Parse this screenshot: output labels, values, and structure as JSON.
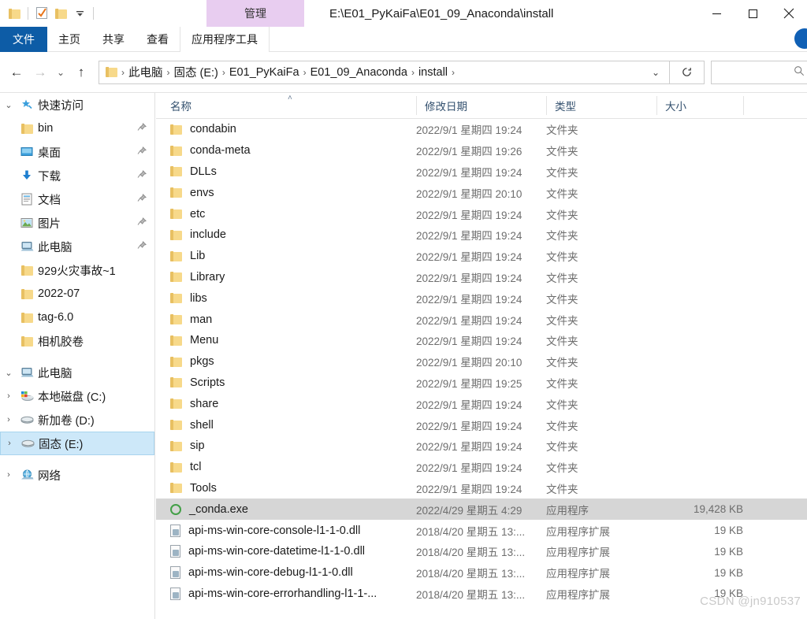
{
  "window": {
    "title": "E:\\E01_PyKaiFa\\E01_09_Anaconda\\install",
    "minimize_label": "─",
    "maximize_label": "☐",
    "close_label": "✕"
  },
  "quick_access_toolbar": {
    "items": [
      {
        "name": "explorer-folder-icon",
        "glyph": "folder"
      },
      {
        "name": "properties-icon",
        "glyph": "checkbox"
      },
      {
        "name": "new-folder-icon",
        "glyph": "folder"
      },
      {
        "name": "customize-dropdown-icon",
        "glyph": "▾"
      }
    ]
  },
  "ribbon": {
    "context_group_label": "管理",
    "tabs": [
      {
        "label": "文件",
        "selected": true,
        "kind": "file"
      },
      {
        "label": "主页",
        "selected": false,
        "kind": "normal"
      },
      {
        "label": "共享",
        "selected": false,
        "kind": "normal"
      },
      {
        "label": "查看",
        "selected": false,
        "kind": "normal"
      },
      {
        "label": "应用程序工具",
        "selected": false,
        "kind": "context"
      }
    ],
    "collapse_icon": "⌄",
    "help_icon": "help-circle"
  },
  "address_bar": {
    "back_icon": "←",
    "forward_icon": "→",
    "recent_icon": "⌄",
    "up_icon": "↑",
    "breadcrumbs": [
      "此电脑",
      "固态 (E:)",
      "E01_PyKaiFa",
      "E01_09_Anaconda",
      "install"
    ],
    "separator": "›",
    "dropdown_icon": "⌄",
    "refresh_icon": "↻",
    "search_placeholder": "",
    "search_value": "",
    "search_icon": "⌕"
  },
  "nav_pane": {
    "sections": [
      {
        "name": "quick-access",
        "expander": "⌄",
        "icon": "star-pin-icon",
        "label": "快速访问",
        "items": [
          {
            "label": "bin",
            "icon": "folder-icon",
            "pinned": true
          },
          {
            "label": "桌面",
            "icon": "desktop-icon",
            "pinned": true
          },
          {
            "label": "下载",
            "icon": "downloads-icon",
            "pinned": true
          },
          {
            "label": "文档",
            "icon": "documents-icon",
            "pinned": true
          },
          {
            "label": "图片",
            "icon": "pictures-icon",
            "pinned": true
          },
          {
            "label": "此电脑",
            "icon": "this-pc-icon",
            "pinned": true
          },
          {
            "label": "929火灾事故~1",
            "icon": "folder-icon",
            "pinned": false
          },
          {
            "label": "2022-07",
            "icon": "folder-icon",
            "pinned": false
          },
          {
            "label": "tag-6.0",
            "icon": "folder-icon",
            "pinned": false
          },
          {
            "label": "相机胶卷",
            "icon": "folder-icon",
            "pinned": false
          }
        ]
      },
      {
        "name": "this-pc",
        "expander": "⌄",
        "icon": "this-pc-icon",
        "label": "此电脑",
        "items": [
          {
            "label": "本地磁盘 (C:)",
            "icon": "windows-drive-icon",
            "expander": "›",
            "selected": false
          },
          {
            "label": "新加卷 (D:)",
            "icon": "drive-icon",
            "expander": "›",
            "selected": false
          },
          {
            "label": "固态 (E:)",
            "icon": "drive-icon",
            "expander": "›",
            "selected": true
          }
        ]
      },
      {
        "name": "network",
        "expander": "›",
        "icon": "network-icon",
        "label": "网络",
        "items": []
      }
    ]
  },
  "file_list": {
    "columns": [
      {
        "key": "name",
        "label": "名称",
        "sorted": true,
        "sort_dir": "asc",
        "sort_caret": "˄"
      },
      {
        "key": "date",
        "label": "修改日期"
      },
      {
        "key": "type",
        "label": "类型"
      },
      {
        "key": "size",
        "label": "大小"
      }
    ],
    "rows": [
      {
        "name": "condabin",
        "date": "2022/9/1 星期四 19:24",
        "type": "文件夹",
        "size": "",
        "icon": "folder-icon",
        "selected": false
      },
      {
        "name": "conda-meta",
        "date": "2022/9/1 星期四 19:26",
        "type": "文件夹",
        "size": "",
        "icon": "folder-icon",
        "selected": false
      },
      {
        "name": "DLLs",
        "date": "2022/9/1 星期四 19:24",
        "type": "文件夹",
        "size": "",
        "icon": "folder-icon",
        "selected": false
      },
      {
        "name": "envs",
        "date": "2022/9/1 星期四 20:10",
        "type": "文件夹",
        "size": "",
        "icon": "folder-icon",
        "selected": false
      },
      {
        "name": "etc",
        "date": "2022/9/1 星期四 19:24",
        "type": "文件夹",
        "size": "",
        "icon": "folder-icon",
        "selected": false
      },
      {
        "name": "include",
        "date": "2022/9/1 星期四 19:24",
        "type": "文件夹",
        "size": "",
        "icon": "folder-icon",
        "selected": false
      },
      {
        "name": "Lib",
        "date": "2022/9/1 星期四 19:24",
        "type": "文件夹",
        "size": "",
        "icon": "folder-icon",
        "selected": false
      },
      {
        "name": "Library",
        "date": "2022/9/1 星期四 19:24",
        "type": "文件夹",
        "size": "",
        "icon": "folder-icon",
        "selected": false
      },
      {
        "name": "libs",
        "date": "2022/9/1 星期四 19:24",
        "type": "文件夹",
        "size": "",
        "icon": "folder-icon",
        "selected": false
      },
      {
        "name": "man",
        "date": "2022/9/1 星期四 19:24",
        "type": "文件夹",
        "size": "",
        "icon": "folder-icon",
        "selected": false
      },
      {
        "name": "Menu",
        "date": "2022/9/1 星期四 19:24",
        "type": "文件夹",
        "size": "",
        "icon": "folder-icon",
        "selected": false
      },
      {
        "name": "pkgs",
        "date": "2022/9/1 星期四 20:10",
        "type": "文件夹",
        "size": "",
        "icon": "folder-icon",
        "selected": false
      },
      {
        "name": "Scripts",
        "date": "2022/9/1 星期四 19:25",
        "type": "文件夹",
        "size": "",
        "icon": "folder-icon",
        "selected": false
      },
      {
        "name": "share",
        "date": "2022/9/1 星期四 19:24",
        "type": "文件夹",
        "size": "",
        "icon": "folder-icon",
        "selected": false
      },
      {
        "name": "shell",
        "date": "2022/9/1 星期四 19:24",
        "type": "文件夹",
        "size": "",
        "icon": "folder-icon",
        "selected": false
      },
      {
        "name": "sip",
        "date": "2022/9/1 星期四 19:24",
        "type": "文件夹",
        "size": "",
        "icon": "folder-icon",
        "selected": false
      },
      {
        "name": "tcl",
        "date": "2022/9/1 星期四 19:24",
        "type": "文件夹",
        "size": "",
        "icon": "folder-icon",
        "selected": false
      },
      {
        "name": "Tools",
        "date": "2022/9/1 星期四 19:24",
        "type": "文件夹",
        "size": "",
        "icon": "folder-icon",
        "selected": false
      },
      {
        "name": "_conda.exe",
        "date": "2022/4/29 星期五 4:29",
        "type": "应用程序",
        "size": "19,428 KB",
        "icon": "anaconda-exe-icon",
        "selected": true
      },
      {
        "name": "api-ms-win-core-console-l1-1-0.dll",
        "date": "2018/4/20 星期五 13:...",
        "type": "应用程序扩展",
        "size": "19 KB",
        "icon": "dll-icon",
        "selected": false
      },
      {
        "name": "api-ms-win-core-datetime-l1-1-0.dll",
        "date": "2018/4/20 星期五 13:...",
        "type": "应用程序扩展",
        "size": "19 KB",
        "icon": "dll-icon",
        "selected": false
      },
      {
        "name": "api-ms-win-core-debug-l1-1-0.dll",
        "date": "2018/4/20 星期五 13:...",
        "type": "应用程序扩展",
        "size": "19 KB",
        "icon": "dll-icon",
        "selected": false
      },
      {
        "name": "api-ms-win-core-errorhandling-l1-1-...",
        "date": "2018/4/20 星期五 13:...",
        "type": "应用程序扩展",
        "size": "19 KB",
        "icon": "dll-icon",
        "selected": false
      }
    ]
  },
  "watermark": {
    "text": "CSDN @jn910537"
  },
  "colors": {
    "file_tab": "#0d5ca6",
    "context_group": "#e8cdf0",
    "selection": "#d6d6d6",
    "nav_selection": "#cde8f9",
    "folder": "#f7d98a",
    "header_text": "#33506e"
  }
}
